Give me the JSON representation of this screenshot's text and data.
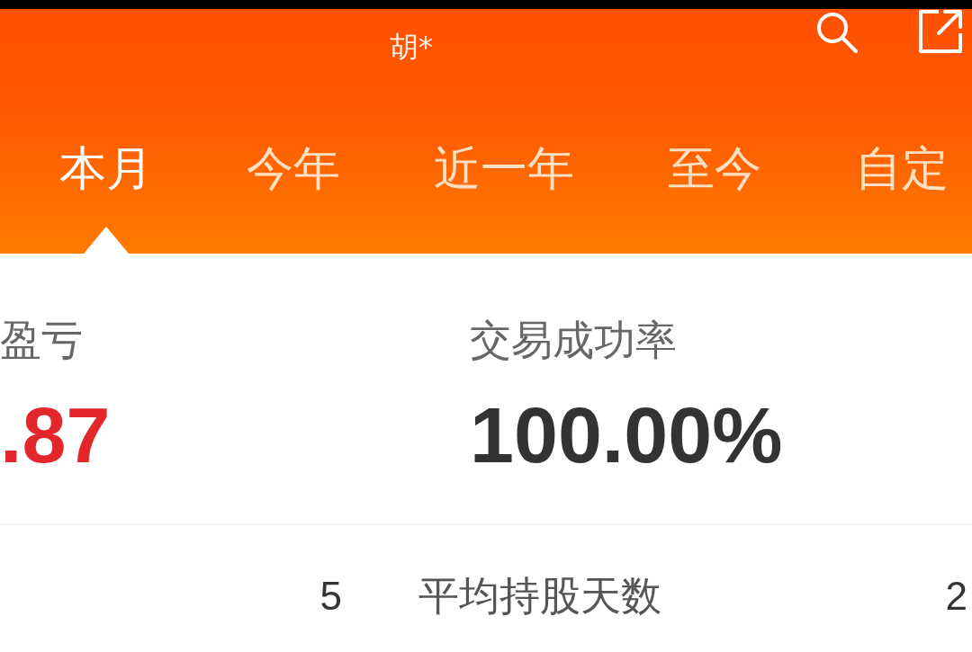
{
  "header": {
    "subtitle": "胡*"
  },
  "tabs": [
    {
      "label": "本月",
      "selected": true
    },
    {
      "label": "今年",
      "selected": false
    },
    {
      "label": "近一年",
      "selected": false
    },
    {
      "label": "至今",
      "selected": false
    },
    {
      "label": "自定",
      "selected": false
    }
  ],
  "summary": [
    {
      "label": "盈亏",
      "value": ".87",
      "color": "#e3262b"
    },
    {
      "label": "交易成功率",
      "value": "100.00%",
      "color": "#333333"
    }
  ],
  "stats": [
    {
      "value": "5"
    },
    {
      "label": "平均持股天数",
      "value": "2"
    }
  ]
}
